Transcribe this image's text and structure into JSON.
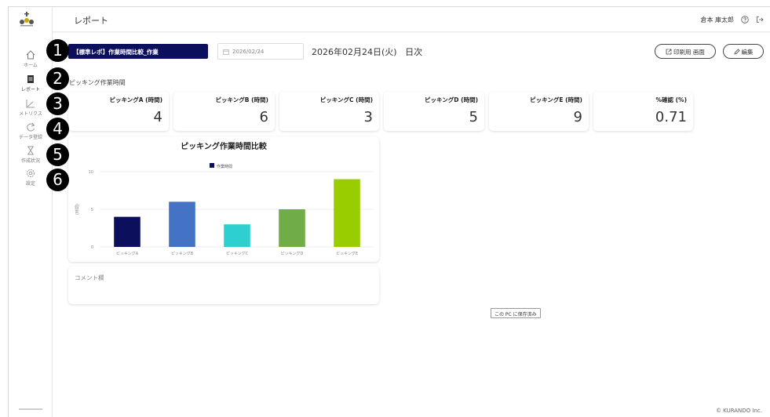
{
  "header": {
    "title": "レポート",
    "user": "倉本 庫太郎"
  },
  "sidebar": {
    "items": [
      {
        "label": "ホーム"
      },
      {
        "label": "レポート"
      },
      {
        "label": "メトリクス"
      },
      {
        "label": "データ登録"
      },
      {
        "label": "作成状況"
      },
      {
        "label": "設定"
      }
    ]
  },
  "toolbar": {
    "report_name": "【標準レポ】作業時間比較_作業",
    "date_value": "2026/02/24",
    "date_display": "2026年02月24日(火)",
    "period": "日次",
    "print_label": "印刷用 画面",
    "edit_label": "編集"
  },
  "section_label": "ピッキング作業時間",
  "kpis": [
    {
      "label": "ピッキングA (時間)",
      "value": "4"
    },
    {
      "label": "ピッキングB (時間)",
      "value": "6"
    },
    {
      "label": "ピッキングC (時間)",
      "value": "3"
    },
    {
      "label": "ピッキングD (時間)",
      "value": "5"
    },
    {
      "label": "ピッキングE (時間)",
      "value": "9"
    },
    {
      "label": "%確認 (%)",
      "value": "0.71"
    }
  ],
  "chart_data": {
    "type": "bar",
    "title": "ピッキング作業時間比較",
    "legend": "作業時間",
    "ylabel": "(時間)",
    "categories": [
      "ピッキングA",
      "ピッキングB",
      "ピッキングC",
      "ピッキングD",
      "ピッキングE"
    ],
    "values": [
      4,
      6,
      3,
      5,
      9
    ],
    "colors": [
      "#0c0f5c",
      "#4472c4",
      "#2ecfd0",
      "#70ad47",
      "#9acd00"
    ],
    "ylim": [
      0,
      10
    ],
    "yticks": [
      0,
      5,
      10
    ]
  },
  "comment": {
    "label": "コメント欄"
  },
  "tooltip": "この PC に保存済み",
  "badges": [
    "1",
    "2",
    "3",
    "4",
    "5",
    "6"
  ],
  "footer": "© KURANDO Inc."
}
